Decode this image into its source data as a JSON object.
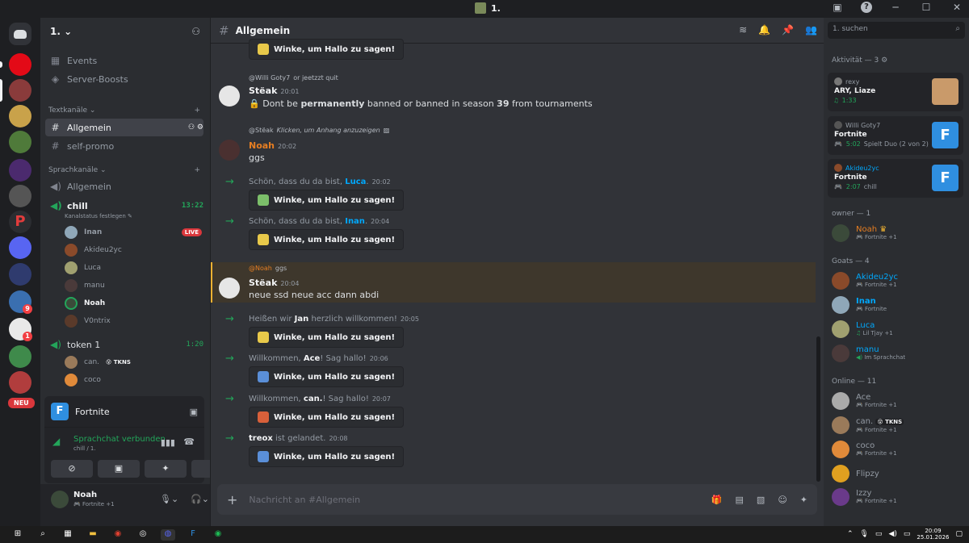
{
  "window": {
    "title": "1."
  },
  "guild": {
    "name": "1."
  },
  "sidebar": {
    "top_items": [
      {
        "label": "Events",
        "icon": "calendar-icon"
      },
      {
        "label": "Server-Boosts",
        "icon": "boost-icon"
      }
    ],
    "text_category": "Textkanäle",
    "text_channels": [
      "Allgemein",
      "self-promo"
    ],
    "voice_category": "Sprachkanäle",
    "voice_channels": {
      "general": "Allgemein",
      "chill": {
        "name": "chill",
        "time": "13:22",
        "status": "Kanalstatus festlegen",
        "users": [
          "Inan",
          "Akideu2yc",
          "Luca",
          "manu",
          "Noah",
          "V0ntrix"
        ],
        "live_label": "LIVE"
      },
      "token": {
        "name": "token 1",
        "time": "1:20",
        "users": [
          "can.",
          "coco"
        ],
        "tag": "TKNS"
      }
    },
    "new_badge": "NEU"
  },
  "activity_panel": {
    "game": "Fortnite"
  },
  "voice_panel": {
    "status": "Sprachchat verbunden",
    "sub": "chill / 1."
  },
  "user_panel": {
    "name": "Noah",
    "status": "Fortnite +1"
  },
  "chat": {
    "channel": "Allgemein",
    "wave_label": "Winke, um Hallo zu sagen!",
    "messages": {
      "m1": {
        "reply_user": "@Willi Goty7",
        "reply_text": "or jeetzzt quit",
        "author": "Stëak",
        "time": "20:01",
        "text_pre": "Dont be ",
        "text_b1": "permanently",
        "text_mid": " banned or banned in season ",
        "text_b2": "39",
        "text_post": " from tournaments"
      },
      "m2": {
        "reply_user": "@Stëak",
        "reply_text": "Klicken, um Anhang anzuzeigen",
        "author": "Noah",
        "time": "20:02",
        "text": "ggs"
      },
      "j1": {
        "pre": "Schön, dass du da bist, ",
        "name": "Luca",
        "post": ".",
        "time": "20:02"
      },
      "j2": {
        "pre": "Schön, dass du da bist, ",
        "name": "Inan",
        "post": ".",
        "time": "20:04"
      },
      "m3": {
        "reply_user": "@Noah",
        "reply_text": "ggs",
        "author": "Stëak",
        "time": "20:04",
        "text": "neue ssd neue acc dann abdi"
      },
      "j3": {
        "pre": "Heißen wir ",
        "name": "Jan",
        "post": " herzlich willkommen!",
        "time": "20:05"
      },
      "j4": {
        "pre": "Willkommen, ",
        "name": "Ace",
        "post": "! Sag hallo!",
        "time": "20:06"
      },
      "j5": {
        "pre": "Willkommen, ",
        "name": "can.",
        "post": "! Sag hallo!",
        "time": "20:07"
      },
      "j6": {
        "pre": "",
        "name": "treox",
        "post": " ist gelandet.",
        "time": "20:08"
      }
    },
    "composer_placeholder": "Nachricht an #Allgemein"
  },
  "members": {
    "search_placeholder": "1. suchen",
    "activity_header": "Aktivität — 3",
    "activities": [
      {
        "user": "rexy",
        "title": "ARY, Liaze",
        "time": "1:33",
        "extra": ""
      },
      {
        "user": "Willi Goty7",
        "title": "Fortnite",
        "time": "5:02",
        "extra": "Spielt Duo (2 von 2)"
      },
      {
        "user": "Akideu2yc",
        "title": "Fortnite",
        "time": "2:07",
        "extra": "chill"
      }
    ],
    "owner_header": "owner — 1",
    "owner": {
      "name": "Noah",
      "status": "Fortnite +1"
    },
    "goats_header": "Goats — 4",
    "goats": [
      {
        "name": "Akideu2yc",
        "status": "Fortnite +1"
      },
      {
        "name": "Inan",
        "status": "Fortnite"
      },
      {
        "name": "Luca",
        "status": "Lil Tjay +1"
      },
      {
        "name": "manu",
        "status": "Im Sprachchat"
      }
    ],
    "online_header": "Online — 11",
    "online": [
      {
        "name": "Ace",
        "status": "Fortnite +1",
        "tag": ""
      },
      {
        "name": "can.",
        "status": "Fortnite +1",
        "tag": "TKNS"
      },
      {
        "name": "coco",
        "status": "Fortnite +1",
        "tag": ""
      },
      {
        "name": "Flipzy",
        "status": "",
        "tag": ""
      },
      {
        "name": "Izzy",
        "status": "Fortnite +1",
        "tag": ""
      }
    ]
  },
  "taskbar": {
    "time": "20:09",
    "date": "25.01.2026"
  },
  "colors": {
    "accent_green": "#23a55a",
    "live_red": "#da373c",
    "link_blue": "#00a8fc",
    "noah_orange": "#e67e22"
  }
}
